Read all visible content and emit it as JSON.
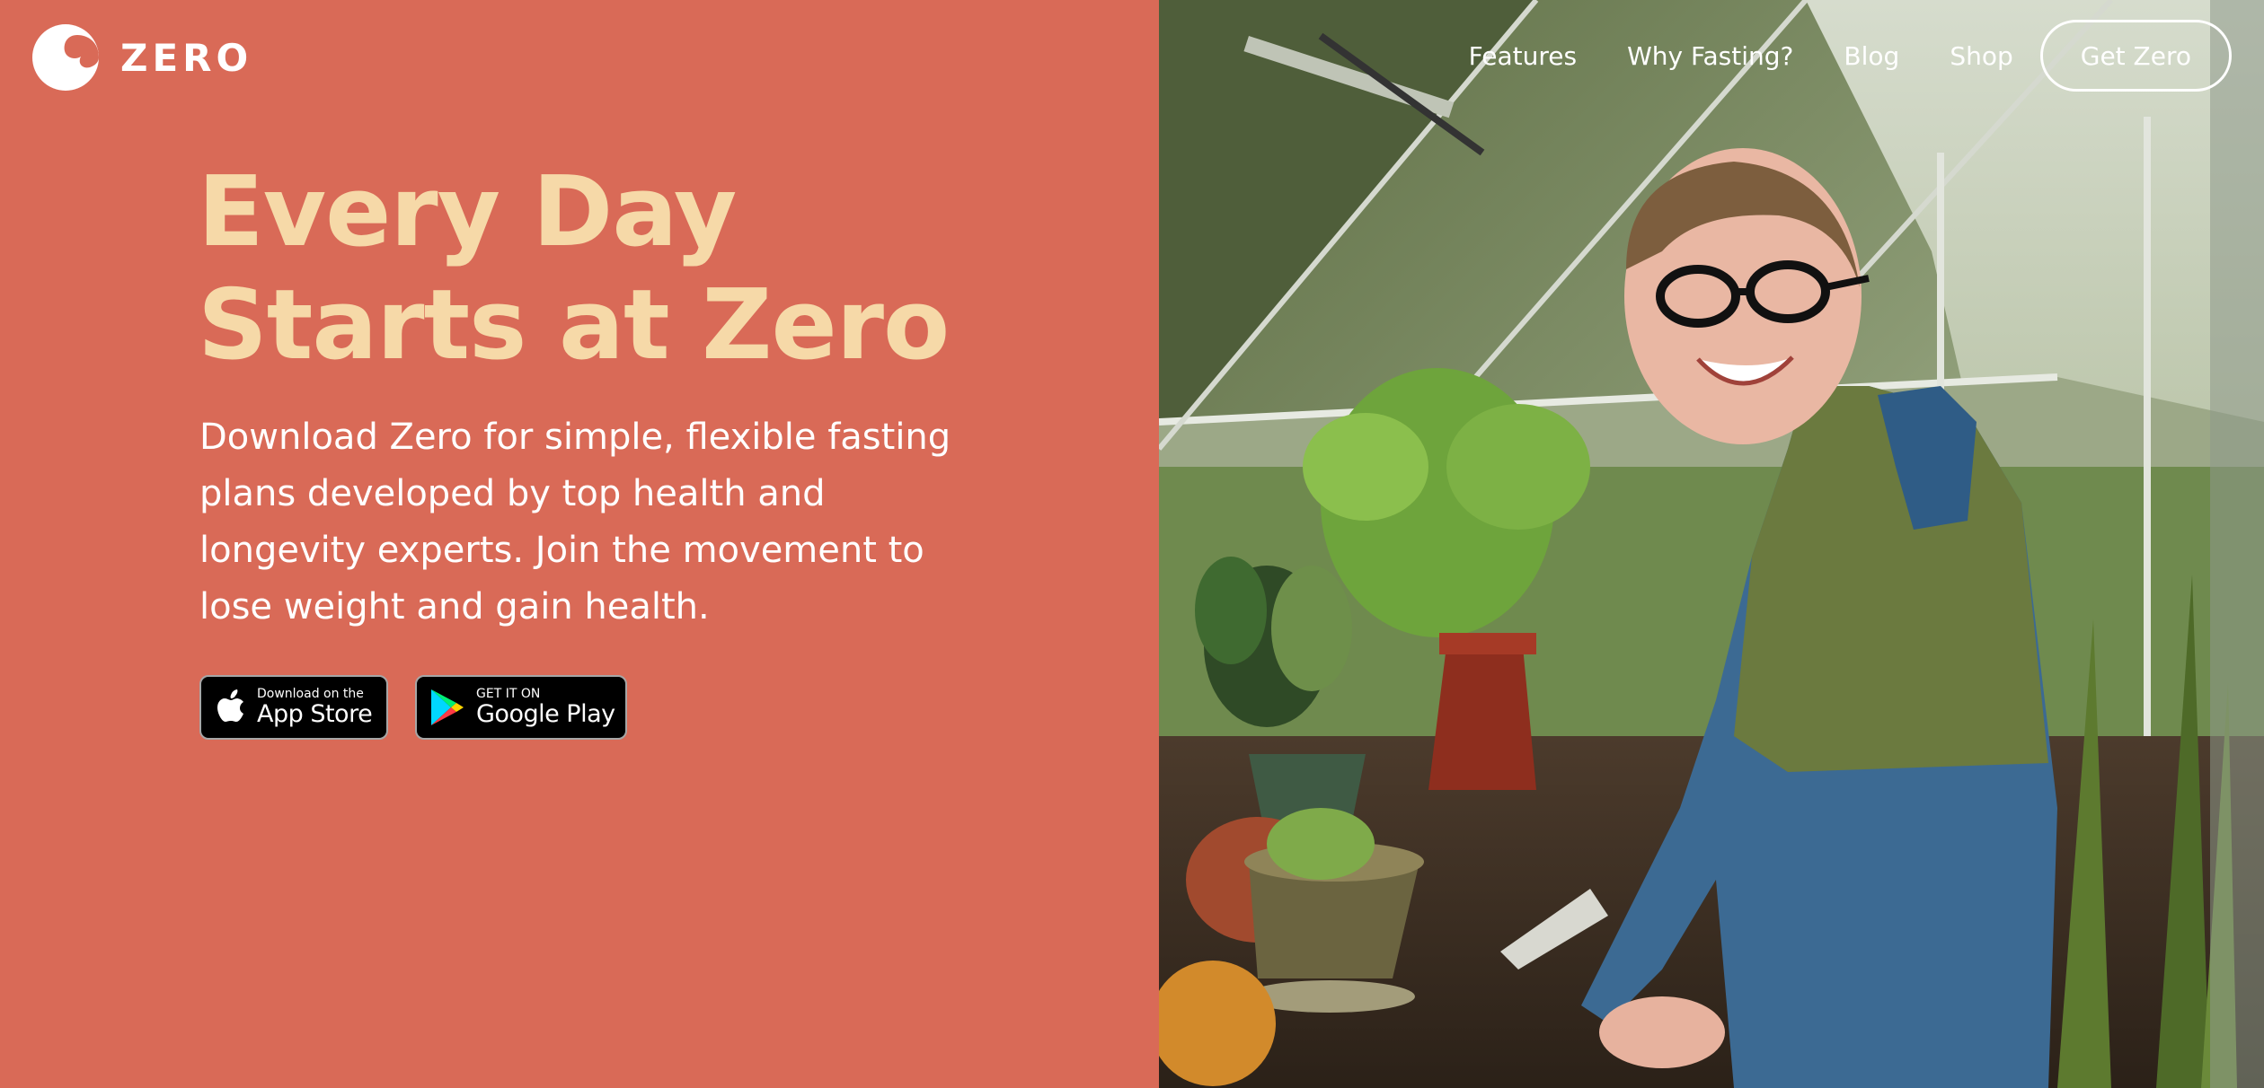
{
  "brand": {
    "name": "ZERO",
    "logo_icon": "crescent-wave-logo-icon",
    "background_color": "#D96A57",
    "accent_color": "#F6D9A8"
  },
  "nav": {
    "links": [
      "Features",
      "Why Fasting?",
      "Blog",
      "Shop"
    ],
    "cta_label": "Get Zero"
  },
  "hero": {
    "title_line1": "Every Day",
    "title_line2": "Starts at Zero",
    "description": "Download Zero for simple, flexible fasting plans developed by top health and longevity experts. Join the movement to lose weight and gain health."
  },
  "badges": {
    "app_store": {
      "small": "Download on the",
      "big": "App Store",
      "icon": "apple-icon"
    },
    "google_play": {
      "small": "GET IT ON",
      "big": "Google Play",
      "icon": "google-play-icon"
    }
  },
  "photo": {
    "icon": "greenhouse-woman-photo"
  }
}
